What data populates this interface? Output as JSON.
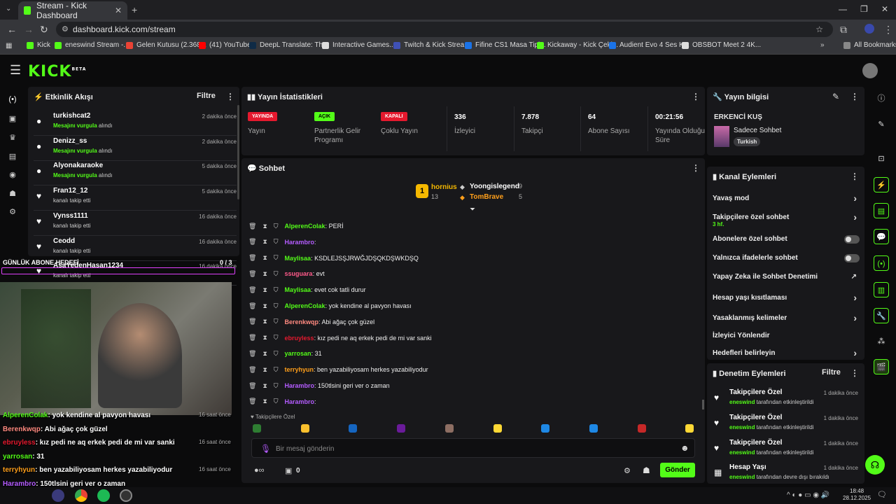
{
  "browser": {
    "tab_title": "Stream - Kick Dashboard",
    "url": "dashboard.kick.com/stream",
    "bookmarks": [
      {
        "label": "Kick",
        "color": "#53fc18"
      },
      {
        "label": "eneswind Stream -...",
        "color": "#53fc18"
      },
      {
        "label": "Gelen Kutusu (2.368...",
        "color": "#ea4335"
      },
      {
        "label": "(41) YouTube",
        "color": "#ff0000"
      },
      {
        "label": "DeepL Translate: Th...",
        "color": "#0f2b46"
      },
      {
        "label": "Interactive Games...",
        "color": "#dddddd"
      },
      {
        "label": "Twitch & Kick Strea...",
        "color": "#3f51b5"
      },
      {
        "label": "Fifine CS1 Masa Tipi...",
        "color": "#1a73e8"
      },
      {
        "label": "Kickaway - Kick Çeki...",
        "color": "#53fc18"
      },
      {
        "label": "Audient Evo 4 Ses K...",
        "color": "#1a73e8"
      },
      {
        "label": "OBSBOT Meet 2 4K...",
        "color": "#dddddd"
      }
    ],
    "all_bookmarks": "All Bookmarks"
  },
  "header": {
    "logo": "KICK",
    "logo_sup": "BETA"
  },
  "activity": {
    "title": "Etkinlik Akışı",
    "filter": "Filtre",
    "items": [
      {
        "name": "turkishcat2",
        "highlight": "Mesajını vurgula",
        "rest": " alındı",
        "time": "2 dakika önce",
        "type": "highlight"
      },
      {
        "name": "Denizz_ss",
        "highlight": "Mesajını vurgula",
        "rest": " alındı",
        "time": "2 dakika önce",
        "type": "highlight"
      },
      {
        "name": "Alyonakaraoke",
        "highlight": "Mesajını vurgula",
        "rest": " alındı",
        "time": "5 dakika önce",
        "type": "highlight"
      },
      {
        "name": "Fran12_12",
        "highlight": "",
        "rest": "kanalı takip etti",
        "time": "5 dakika önce",
        "type": "follow"
      },
      {
        "name": "Vynss1111",
        "highlight": "",
        "rest": "kanalı takip etti",
        "time": "16 dakika önce",
        "type": "follow"
      },
      {
        "name": "Ceodd",
        "highlight": "",
        "rest": "kanalı takip etti",
        "time": "16 dakika önce",
        "type": "follow"
      },
      {
        "name": "AsaYedenHasan1234",
        "highlight": "",
        "rest": "kanalı takip etti",
        "time": "16 dakika önce",
        "type": "follow"
      }
    ]
  },
  "sub_goal": {
    "label": "GÜNLÜK ABONE HEDEFİ",
    "value": "0 / 3"
  },
  "stats": {
    "title": "Yayın İstatistikleri",
    "items": [
      {
        "badge": "YAYINDA",
        "badge_color": "#e5192e",
        "label": "Yayın"
      },
      {
        "badge": "AÇIK",
        "badge_color": "#53fc18",
        "label": "Partnerlik Gelir Programı"
      },
      {
        "badge": "KAPALI",
        "badge_color": "#e5192e",
        "label": "Çoklu Yayın"
      },
      {
        "value": "336",
        "label": "İzleyici"
      },
      {
        "value": "7.878",
        "label": "Takipçi"
      },
      {
        "value": "64",
        "label": "Abone Sayısı"
      },
      {
        "value": "00:21:56",
        "label": "Yayında Olduğu Süre"
      }
    ]
  },
  "stream_info": {
    "title": "Yayın bilgisi",
    "stream_title": "ERKENCİ KUŞ",
    "category": "Sadece Sohbet",
    "language": "Turkish"
  },
  "chat": {
    "title": "Sohbet",
    "leaderboard": {
      "first": {
        "name": "hornius",
        "count": "13",
        "rank": "1"
      },
      "second": {
        "name": "Yoongislegend",
        "count": "9"
      },
      "third": {
        "name": "TomBrave",
        "count": "5"
      }
    },
    "messages": [
      {
        "user": "AlperenColak",
        "color": "#53fc18",
        "text": ": PERİ"
      },
      {
        "user": "Harambro",
        "color": "#b45cff",
        "text": ":"
      },
      {
        "user": "Maylisaa",
        "color": "#53fc18",
        "text": ": KSDLEJSŞJRWĞJDŞQKDŞWKDŞQ"
      },
      {
        "user": "ssuguara",
        "color": "#ff5a8a",
        "text": ": evt"
      },
      {
        "user": "Maylisaa",
        "color": "#53fc18",
        "text": ": evet cok tatli durur"
      },
      {
        "user": "AlperenColak",
        "color": "#53fc18",
        "text": ": yok kendine al pavyon havası"
      },
      {
        "user": "Berenkwqp",
        "color": "#ff8a80",
        "text": ": Abi ağaç çok güzel"
      },
      {
        "user": "ebruyless",
        "color": "#e5192e",
        "text": ": kız pedi ne aq erkek pedi de mi var sanki"
      },
      {
        "user": "yarrosan",
        "color": "#53fc18",
        "text": ": 31"
      },
      {
        "user": "terryhyun",
        "color": "#ff9f1a",
        "text": ": ben yazabiliyosam herkes yazabiliyodur"
      },
      {
        "user": "Harambro",
        "color": "#b45cff",
        "text": ": 150tlsini geri ver o zaman"
      },
      {
        "user": "Harambro",
        "color": "#b45cff",
        "text": ":"
      }
    ],
    "mode": "Takipçilere Özel",
    "placeholder": "Bir mesaj gönderin",
    "points": "0",
    "send": "Gönder"
  },
  "channel_actions": {
    "title": "Kanal Eylemleri",
    "items": [
      {
        "label": "Yavaş mod",
        "kind": "arrow"
      },
      {
        "label": "Takipçilere özel sohbet",
        "sub": "3 hf.",
        "kind": "arrow"
      },
      {
        "label": "Abonelere özel sohbet",
        "kind": "toggle"
      },
      {
        "label": "Yalnızca ifadelerle sohbet",
        "kind": "toggle"
      },
      {
        "label": "Yapay Zeka ile Sohbet Denetimi",
        "kind": "external"
      },
      {
        "label": "Hesap yaşı kısıtlaması",
        "kind": "arrow"
      },
      {
        "label": "Yasaklanmış kelimeler",
        "kind": "arrow"
      },
      {
        "label": "İzleyici Yönlendir",
        "kind": "none"
      },
      {
        "label": "Hedefleri belirleyin",
        "kind": "arrow"
      }
    ]
  },
  "mod_actions": {
    "title": "Denetim Eylemleri",
    "filter": "Filtre",
    "items": [
      {
        "name": "Takipçilere Özel",
        "user": "eneswind",
        "rest": " tarafından etkinleştirildi",
        "time": "1 dakika önce"
      },
      {
        "name": "Takipçilere Özel",
        "user": "eneswind",
        "rest": " tarafından etkinleştirildi",
        "time": "1 dakika önce"
      },
      {
        "name": "Takipçilere Özel",
        "user": "eneswind",
        "rest": " tarafından etkinleştirildi",
        "time": "1 dakika önce"
      },
      {
        "name": "Hesap Yaşı",
        "user": "eneswind",
        "rest": " tarafından devre dışı bırakıldı",
        "time": "1 dakika önce"
      }
    ]
  },
  "overlay_chat": [
    {
      "user": "AlperenColak",
      "color": "#53fc18",
      "text": ": yok kendine al pavyon havası",
      "time": "16 saat önce"
    },
    {
      "user": "Berenkwqp",
      "color": "#ff8a80",
      "text": ": Abi ağaç çok güzel",
      "time": ""
    },
    {
      "user": "ebruyless",
      "color": "#e5192e",
      "text": ": kız pedi ne aq erkek pedi de mi var sanki",
      "time": "16 saat önce"
    },
    {
      "user": "yarrosan",
      "color": "#53fc18",
      "text": ": 31",
      "time": ""
    },
    {
      "user": "terryhyun",
      "color": "#ff9f1a",
      "text": ": ben yazabiliyosam herkes yazabiliyodur",
      "time": "16 saat önce"
    },
    {
      "user": "Harambro",
      "color": "#b45cff",
      "text": ": 150tlsini geri ver o zaman",
      "time": ""
    },
    {
      "user": "Harambro",
      "color": "#b45cff",
      "text": ":",
      "time": ""
    }
  ],
  "taskbar": {
    "time": "18:48",
    "date": "28.12.2025"
  }
}
